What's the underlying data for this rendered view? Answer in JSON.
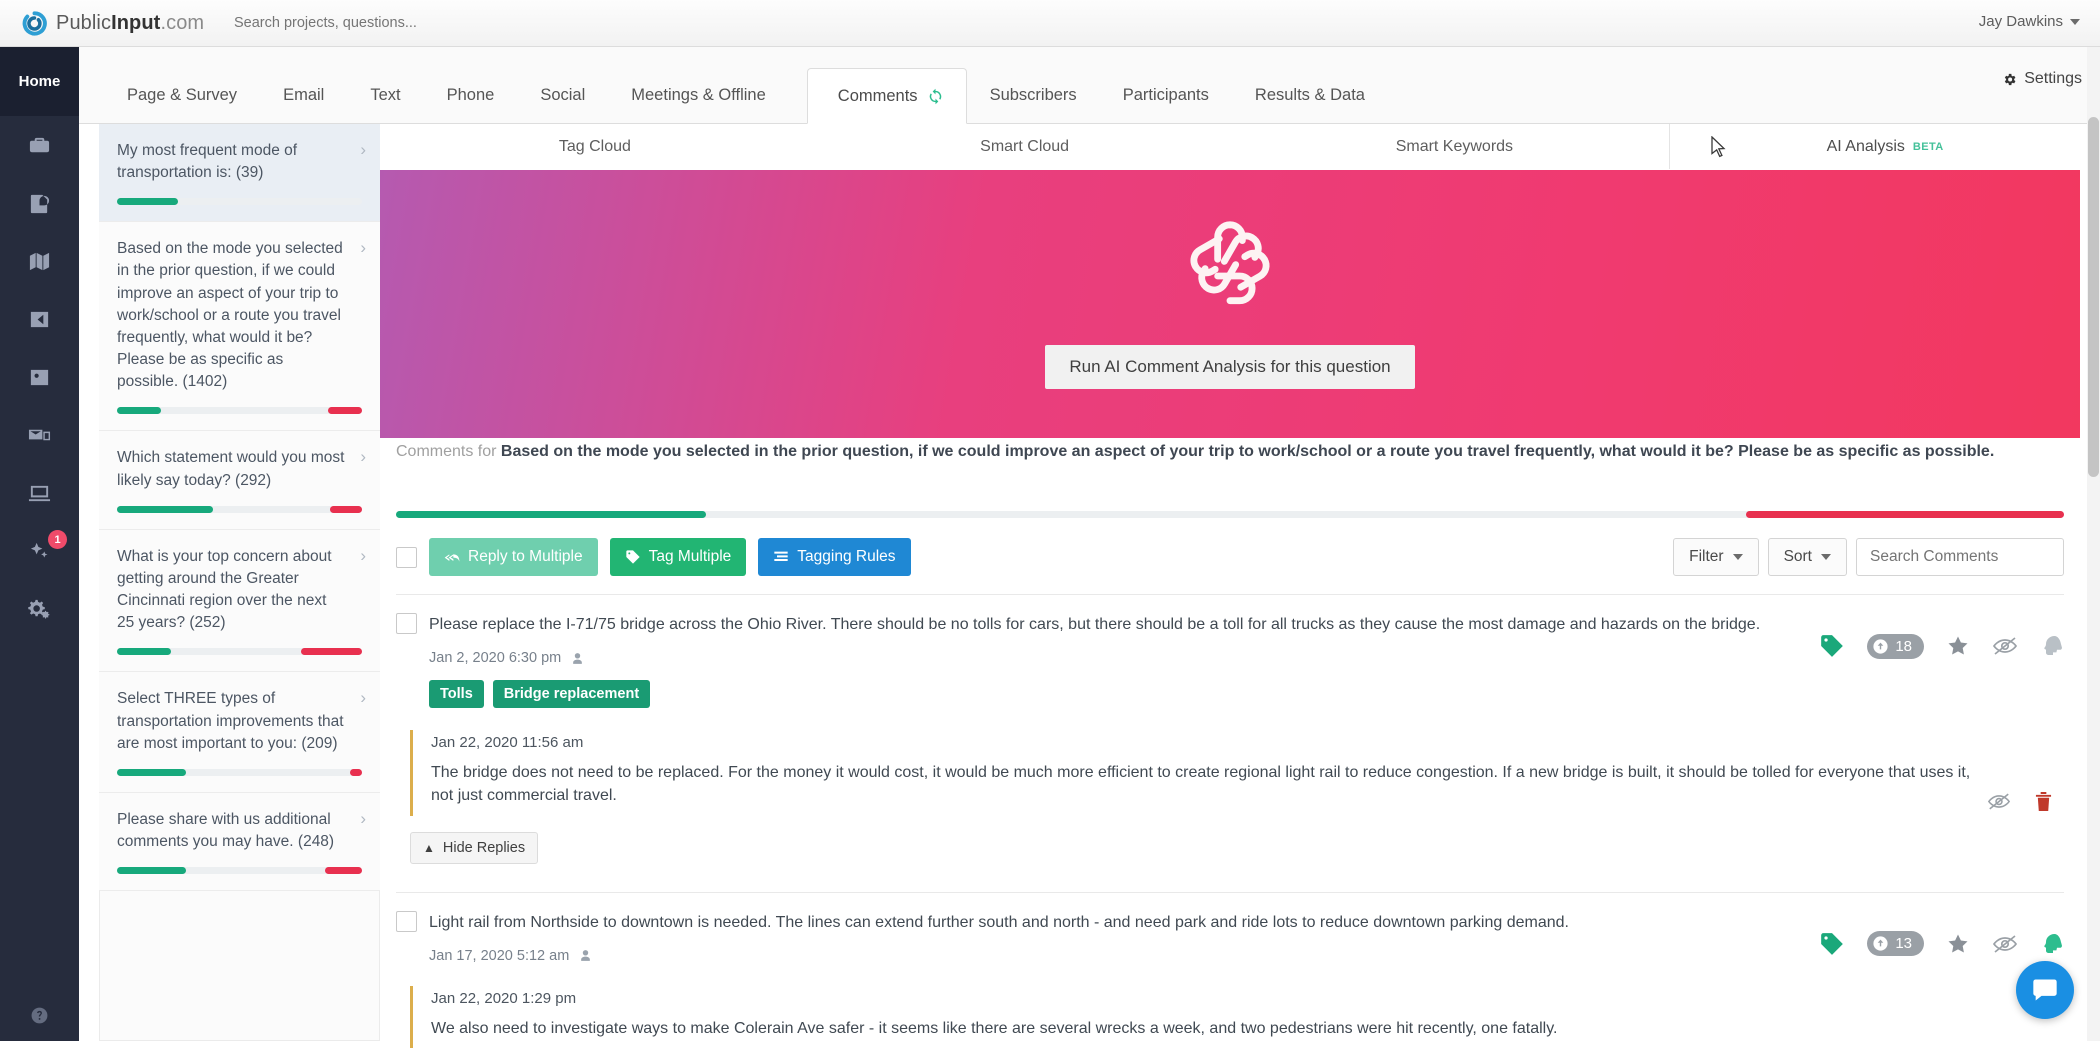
{
  "topbar": {
    "brand_prefix": "Public",
    "brand_bold": "Input",
    "brand_suffix": ".com",
    "search_placeholder": "Search projects, questions...",
    "search_value": "",
    "user_name": "Jay Dawkins"
  },
  "rail": {
    "home_label": "Home",
    "items": [
      {
        "icon": "briefcase-icon",
        "name": "projects"
      },
      {
        "icon": "report-icon",
        "name": "reports"
      },
      {
        "icon": "map-icon",
        "name": "maps"
      },
      {
        "icon": "share-icon",
        "name": "share"
      },
      {
        "icon": "contacts-icon",
        "name": "contacts"
      },
      {
        "icon": "mail-stack-icon",
        "name": "outreach"
      },
      {
        "icon": "presentation-icon",
        "name": "media"
      },
      {
        "icon": "sparkles-icon",
        "name": "ai",
        "badge": "1"
      },
      {
        "icon": "gears-icon",
        "name": "admin"
      }
    ],
    "help_icon": "help-circle-icon"
  },
  "nav": {
    "tabs": [
      {
        "label": "Page & Survey",
        "active": false
      },
      {
        "label": "Email",
        "active": false
      },
      {
        "label": "Text",
        "active": false
      },
      {
        "label": "Phone",
        "active": false
      },
      {
        "label": "Social",
        "active": false
      },
      {
        "label": "Meetings & Offline",
        "active": false
      },
      {
        "label": "Comments",
        "active": true,
        "icon": "refresh-icon"
      },
      {
        "label": "Subscribers",
        "active": false
      },
      {
        "label": "Participants",
        "active": false
      },
      {
        "label": "Results & Data",
        "active": false
      }
    ],
    "settings_label": "Settings"
  },
  "subtabs": [
    {
      "label": "Tag Cloud",
      "active": false
    },
    {
      "label": "Smart Cloud",
      "active": false
    },
    {
      "label": "Smart Keywords",
      "active": false
    },
    {
      "label": "AI Analysis",
      "badge": "BETA",
      "active": true
    }
  ],
  "questions": [
    {
      "text": "My most frequent mode of transportation is: (39)",
      "active": true,
      "green_pct": 25,
      "red_pct": 0
    },
    {
      "text": "Based on the mode you selected in the prior question, if we could improve an aspect of your trip to work/school or a route you travel frequently, what would it be? Please be as specific as possible. (1402)",
      "active": false,
      "green_pct": 18,
      "red_pct": 14
    },
    {
      "text": "Which statement would you most likely say today? (292)",
      "active": false,
      "green_pct": 39,
      "red_pct": 13
    },
    {
      "text": "What is your top concern about getting around the Greater Cincinnati region over the next 25 years? (252)",
      "active": false,
      "green_pct": 22,
      "red_pct": 25
    },
    {
      "text": "Select THREE types of transportation improvements that are most important to you: (209)",
      "active": false,
      "green_pct": 28,
      "red_pct": 5
    },
    {
      "text": "Please share with us additional comments you may have. (248)",
      "active": false,
      "green_pct": 28,
      "red_pct": 15
    }
  ],
  "ai_banner": {
    "logo": "openai-logo",
    "run_button_label": "Run AI Comment Analysis for this question",
    "gradient_from": "#b55ab0",
    "gradient_to": "#f2385f"
  },
  "comments_header": {
    "label": "Comments for",
    "question": "Based on the mode you selected in the prior question, if we could improve an aspect of your trip to work/school or a route you travel frequently, what would it be? Please be as specific as possible."
  },
  "toolbar": {
    "select_all_checked": false,
    "reply_multiple_label": "Reply to Multiple",
    "tag_multiple_label": "Tag Multiple",
    "tagging_rules_label": "Tagging Rules",
    "filter_label": "Filter",
    "sort_label": "Sort",
    "search_placeholder": "Search Comments",
    "search_value": ""
  },
  "comments": [
    {
      "text": "Please replace the I-71/75 bridge across the Ohio River. There should be no tolls for cars, but there should be a toll for all trucks as they cause the most damage and hazards on the bridge.",
      "date": "Jan 2, 2020 6:30 pm",
      "tags": [
        "Tolls",
        "Bridge replacement"
      ],
      "votes": "18",
      "head_icon_green": false,
      "replies": [
        {
          "date": "Jan 22, 2020 11:56 am",
          "text": "The bridge does not need to be replaced. For the money it would cost, it would be much more efficient to create regional light rail to reduce congestion. If a new bridge is built, it should be tolled for everyone that uses it, not just commercial travel."
        }
      ],
      "hide_replies_label": "Hide Replies"
    },
    {
      "text": "Light rail from Northside to downtown is needed. The lines can extend further south and north - and need park and ride lots to reduce downtown parking demand.",
      "date": "Jan 17, 2020 5:12 am",
      "tags": [],
      "votes": "13",
      "head_icon_green": true,
      "replies": [
        {
          "date": "Jan 22, 2020 1:29 pm",
          "text": "We also need to investigate ways to make Colerain Ave safer - it seems like there are several wrecks a week, and two pedestrians were hit recently, one fatally."
        }
      ],
      "hide_replies_label": ""
    }
  ],
  "chat": {
    "icon": "chat-bubble-icon"
  },
  "colors": {
    "green": "#17a97c",
    "red": "#e8304f",
    "blue": "#1f88d4",
    "rail": "#262c3d",
    "beta": "#45c19a"
  }
}
